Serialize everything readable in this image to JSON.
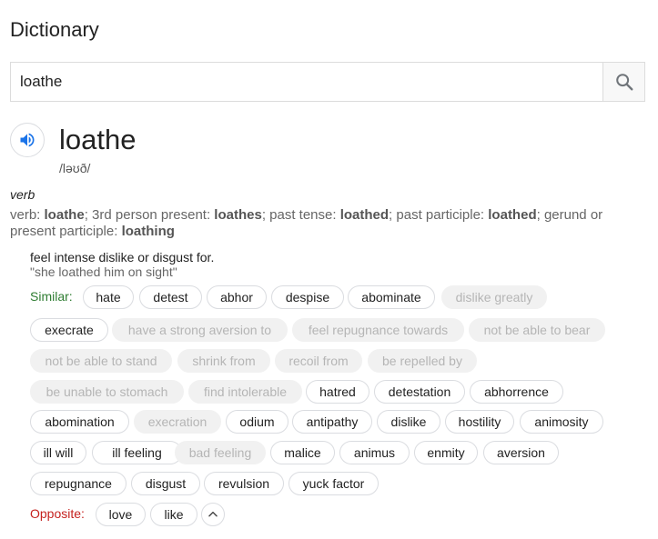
{
  "header": {
    "title": "Dictionary"
  },
  "search": {
    "value": "loathe"
  },
  "entry": {
    "word": "loathe",
    "phonetic": "/ləʊð/",
    "part_of_speech": "verb",
    "forms": {
      "prefix": "verb: ",
      "base": "loathe",
      "third_label": "; 3rd person present: ",
      "third": "loathes",
      "past_label": "; past tense: ",
      "past": "loathed",
      "pp_label": "; past participle: ",
      "pp": "loathed",
      "ger_label": "; gerund or present participle: ",
      "ger": "loathing"
    },
    "definition": "feel intense dislike or disgust for.",
    "example": "\"she loathed him on sight\""
  },
  "similar": {
    "label": "Similar:",
    "chips": [
      {
        "text": "hate",
        "dim": false
      },
      {
        "text": "detest",
        "dim": false
      },
      {
        "text": "abhor",
        "dim": false
      },
      {
        "text": "despise",
        "dim": false
      },
      {
        "text": "abominate",
        "dim": false
      },
      {
        "text": "dislike greatly",
        "dim": true
      },
      {
        "text": "execrate",
        "dim": false
      },
      {
        "text": "have a strong aversion to",
        "dim": true
      },
      {
        "text": "feel repugnance towards",
        "dim": true
      },
      {
        "text": "not be able to bear",
        "dim": true
      },
      {
        "text": "not be able to stand",
        "dim": true
      },
      {
        "text": "shrink from",
        "dim": true
      },
      {
        "text": "recoil from",
        "dim": true
      },
      {
        "text": "be repelled by",
        "dim": true
      },
      {
        "text": "be unable to stomach",
        "dim": true
      },
      {
        "text": "find intolerable",
        "dim": true
      },
      {
        "text": "hatred",
        "dim": false
      },
      {
        "text": "detestation",
        "dim": false
      },
      {
        "text": "abhorrence",
        "dim": false
      },
      {
        "text": "abomination",
        "dim": false
      },
      {
        "text": "execration",
        "dim": true
      },
      {
        "text": "odium",
        "dim": false
      },
      {
        "text": "antipathy",
        "dim": false
      },
      {
        "text": "dislike",
        "dim": false
      },
      {
        "text": "hostility",
        "dim": false
      },
      {
        "text": "animosity",
        "dim": false
      },
      {
        "text": "ill will",
        "dim": false
      },
      {
        "text": "ill feeling",
        "dim": false
      },
      {
        "text": "bad feeling",
        "dim": true
      },
      {
        "text": "malice",
        "dim": false
      },
      {
        "text": "animus",
        "dim": false
      },
      {
        "text": "enmity",
        "dim": false
      },
      {
        "text": "aversion",
        "dim": false
      },
      {
        "text": "repugnance",
        "dim": false
      },
      {
        "text": "disgust",
        "dim": false
      },
      {
        "text": "revulsion",
        "dim": false
      },
      {
        "text": "yuck factor",
        "dim": false
      }
    ]
  },
  "opposite": {
    "label": "Opposite:",
    "chips": [
      {
        "text": "love",
        "dim": false
      },
      {
        "text": "like",
        "dim": false
      }
    ]
  },
  "icons": {
    "search": "search-icon",
    "speaker": "speaker-icon",
    "collapse": "chevron-up-icon"
  },
  "colors": {
    "similar_label": "#2f7d32",
    "opposite_label": "#c5221f",
    "speaker_blue": "#1a73e8"
  }
}
